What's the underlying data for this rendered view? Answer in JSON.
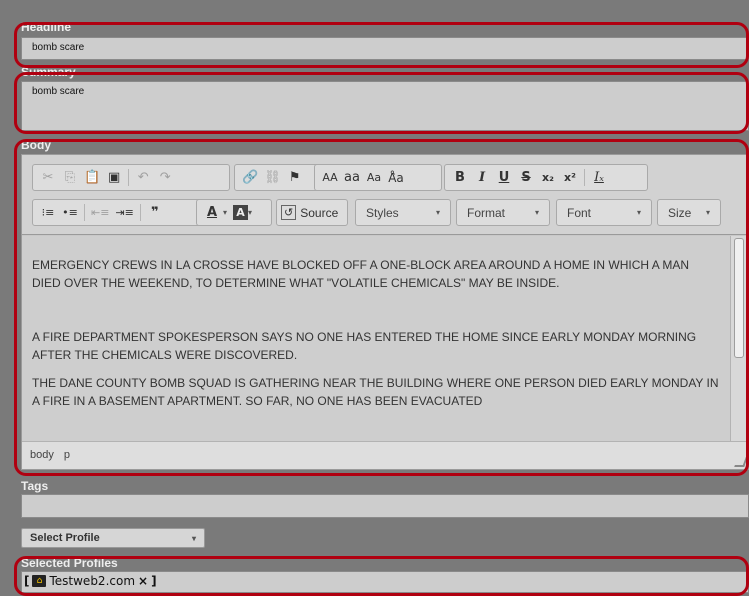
{
  "headline": {
    "label": "Headline",
    "value": "bomb scare"
  },
  "summary": {
    "label": "Summary",
    "value": "bomb scare"
  },
  "body": {
    "label": "Body",
    "toolbar": {
      "row1": {
        "clipboard": [
          "✂",
          "⎘",
          "📋",
          "▣"
        ],
        "undo": "↶",
        "redo": "↷",
        "link": "🔗",
        "unlink": "⛓",
        "anchor": "⚑",
        "case": [
          "AA",
          "aa",
          "Aa",
          "Å̂a"
        ],
        "format": [
          "B",
          "I",
          "U",
          "S",
          "x₂",
          "x²",
          "Iₓ"
        ]
      },
      "row2": {
        "lists": [
          "⁝≡",
          "•≡",
          "⇤≡",
          "⇥≡",
          "❞"
        ],
        "text_color": "A",
        "bg_color": "A",
        "source_label": "Source",
        "styles_label": "Styles",
        "format_label": "Format",
        "font_label": "Font",
        "size_label": "Size"
      }
    },
    "paragraphs": [
      " EMERGENCY CREWS IN LA CROSSE HAVE BLOCKED OFF A ONE-BLOCK AREA AROUND A HOME IN WHICH A MAN DIED OVER THE WEEKEND, TO DETERMINE WHAT \"VOLATILE CHEMICALS\" MAY BE INSIDE.",
      "A FIRE DEPARTMENT SPOKESPERSON SAYS NO ONE HAS ENTERED THE HOME SINCE EARLY MONDAY MORNING AFTER THE CHEMICALS WERE DISCOVERED.",
      "THE DANE COUNTY BOMB SQUAD IS GATHERING NEAR THE BUILDING WHERE ONE PERSON DIED EARLY MONDAY IN A FIRE IN A BASEMENT APARTMENT. SO FAR, NO ONE HAS BEEN EVACUATED"
    ],
    "path": [
      "body",
      "p"
    ]
  },
  "tags": {
    "label": "Tags",
    "value": ""
  },
  "select_profile": {
    "label": "Select Profile"
  },
  "selected_profiles": {
    "label": "Selected Profiles",
    "items": [
      {
        "name": "Testweb2.com",
        "remove": "×"
      }
    ]
  },
  "colors": {
    "highlight": "#b00010",
    "background": "#7a7a7a",
    "field": "#cdcdcd"
  }
}
